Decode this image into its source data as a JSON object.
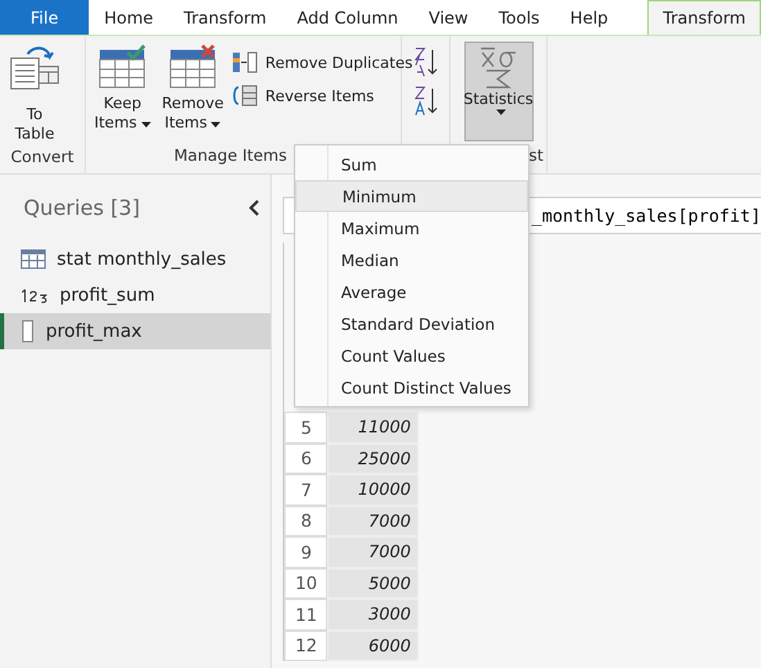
{
  "tabs": [
    {
      "label": "File",
      "kind": "file",
      "selected": false
    },
    {
      "label": "Home",
      "kind": "tab",
      "selected": false
    },
    {
      "label": "Transform",
      "kind": "tab",
      "selected": false
    },
    {
      "label": "Add Column",
      "kind": "tab",
      "selected": false
    },
    {
      "label": "View",
      "kind": "tab",
      "selected": false
    },
    {
      "label": "Tools",
      "kind": "tab",
      "selected": false
    },
    {
      "label": "Help",
      "kind": "tab",
      "selected": false
    },
    {
      "label": "Transform",
      "kind": "tab",
      "selected": true
    }
  ],
  "ribbon": {
    "convert": {
      "label": "Convert",
      "to_table": "To\nTable"
    },
    "manage_items": {
      "label": "Manage Items",
      "keep": "Keep\nItems",
      "remove": "Remove\nItems",
      "remove_duplicates": "Remove Duplicates",
      "reverse_items": "Reverse Items"
    },
    "statistics": {
      "label": "st",
      "button": "Statistics",
      "pressed": true
    }
  },
  "statistics_menu": [
    {
      "label": "Sum",
      "selected": false
    },
    {
      "label": "Minimum",
      "selected": true
    },
    {
      "label": "Maximum",
      "selected": false
    },
    {
      "label": "Median",
      "selected": false
    },
    {
      "label": "Average",
      "selected": false
    },
    {
      "label": "Standard Deviation",
      "selected": false
    },
    {
      "label": "Count Values",
      "selected": false
    },
    {
      "label": "Count Distinct Values",
      "selected": false
    }
  ],
  "queries": {
    "title": "Queries [3]",
    "items": [
      {
        "name": "stat monthly_sales",
        "kind": "table",
        "selected": false
      },
      {
        "name": "profit_sum",
        "kind": "number",
        "selected": false
      },
      {
        "name": "profit_max",
        "kind": "list",
        "selected": true
      }
    ]
  },
  "formula": "_monthly_sales[profit]",
  "rows": [
    {
      "index": "5",
      "value": "11000"
    },
    {
      "index": "6",
      "value": "25000"
    },
    {
      "index": "7",
      "value": "10000"
    },
    {
      "index": "8",
      "value": "7000"
    },
    {
      "index": "9",
      "value": "7000"
    },
    {
      "index": "10",
      "value": "5000"
    },
    {
      "index": "11",
      "value": "3000"
    },
    {
      "index": "12",
      "value": "6000"
    }
  ]
}
